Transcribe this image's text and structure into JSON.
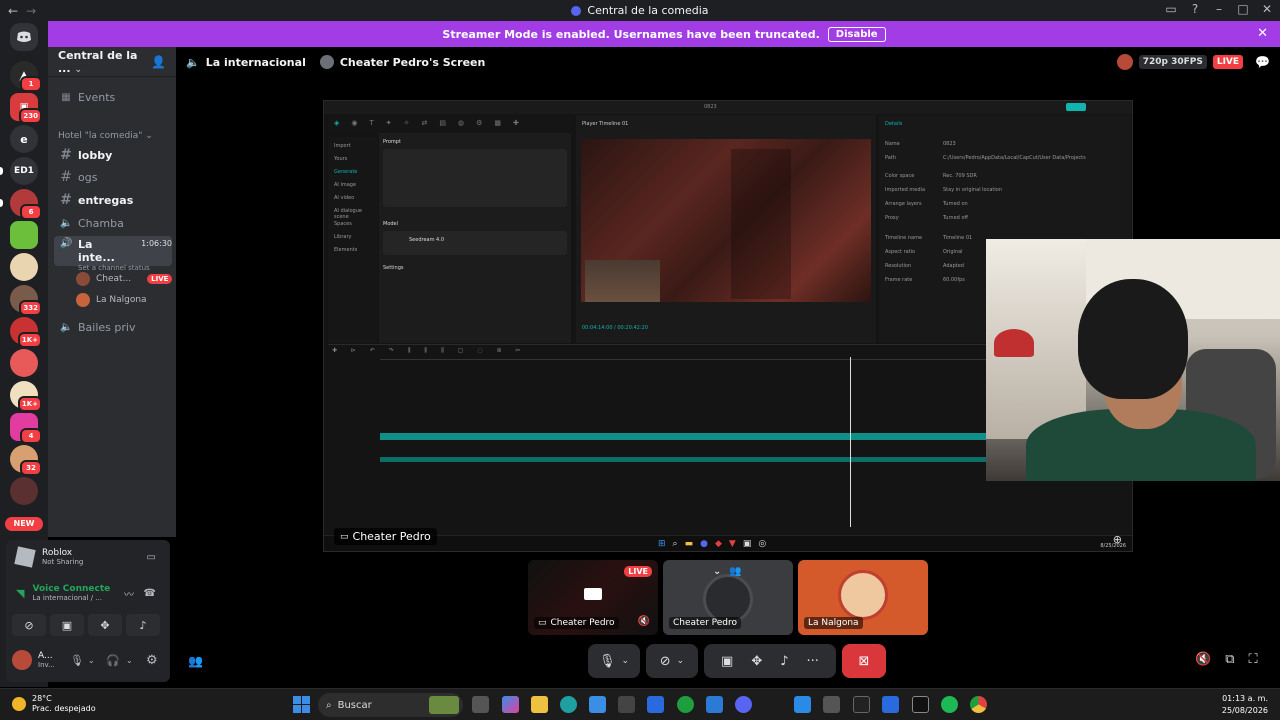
{
  "window": {
    "title": "Central de la comedia",
    "back": "←",
    "forward": "→"
  },
  "banner": {
    "text": "Streamer Mode is enabled. Usernames have been truncated.",
    "disable_label": "Disable",
    "close": "✕"
  },
  "rail": {
    "servers": [
      {
        "badge": "1"
      },
      {
        "badge": "230"
      },
      {
        "label": "e"
      },
      {
        "label": "ED1"
      },
      {
        "badge": "6"
      },
      {
        "badge": ""
      },
      {
        "badge": ""
      },
      {
        "badge": "332"
      },
      {
        "badge": "1K+"
      },
      {
        "badge": ""
      },
      {
        "badge": "1K+"
      },
      {
        "badge": "4"
      },
      {
        "badge": "32"
      },
      {
        "badge": ""
      }
    ],
    "new_label": "NEW"
  },
  "sidebar": {
    "server_name": "Central de la ...",
    "events_label": "Events",
    "category": "Hotel \"la comedia\"",
    "channels": [
      {
        "name": "lobby",
        "type": "text",
        "bold": true
      },
      {
        "name": "ogs",
        "type": "text",
        "bold": false
      },
      {
        "name": "entregas",
        "type": "text",
        "bold": true
      },
      {
        "name": "Chamba",
        "type": "voice",
        "bold": false
      },
      {
        "name": "La inte...",
        "type": "voice",
        "bold": true,
        "active": true,
        "time": "1:06:30",
        "status": "Set a channel status"
      },
      {
        "name": "Bailes priv",
        "type": "voice",
        "bold": false
      }
    ],
    "voice_users": [
      {
        "name": "Cheat...",
        "live": "LIVE"
      },
      {
        "name": "La Nalgona"
      }
    ]
  },
  "panel": {
    "game_name": "Roblox",
    "game_status": "Not Sharing",
    "voice_title": "Voice Connecte",
    "voice_sub": "La internacional / ...",
    "user_name": "A...",
    "user_sub": "Inv..."
  },
  "stage": {
    "channel": "La internacional",
    "screen_title": "Cheater Pedro's Screen",
    "quality": "720p 30FPS",
    "live": "LIVE"
  },
  "screen": {
    "label": "Cheater Pedro",
    "app": {
      "player_title": "Player  Timeline 01",
      "details_title": "Details",
      "prompt_label": "Prompt",
      "model_label": "Model",
      "model_name": "Seedream 4.0",
      "settings_label": "Settings",
      "menu": [
        "Import",
        "Yours",
        "Generate",
        "AI image",
        "AI video",
        "AI dialogue scene",
        "Spaces",
        "Library",
        "Elements"
      ],
      "details_rows": [
        [
          "Name",
          "0823"
        ],
        [
          "Path",
          "C:/Users/Pedro/AppData/Local/CapCut/User Data/Projects"
        ],
        [
          "Color space",
          "Rec. 709 SDR"
        ],
        [
          "Imported media",
          "Stay in original location"
        ],
        [
          "Arrange layers",
          "Turned on"
        ],
        [
          "Proxy",
          "Turned off"
        ],
        [
          "Timeline name",
          "Timeline 01"
        ],
        [
          "Aspect ratio",
          "Original"
        ],
        [
          "Resolution",
          "Adapted"
        ],
        [
          "Frame rate",
          "60.00fps"
        ]
      ],
      "date": "8/25/2026"
    }
  },
  "thumbs": [
    {
      "name": "Cheater Pedro",
      "live": "LIVE"
    },
    {
      "name": "Cheater Pedro"
    },
    {
      "name": "La Nalgona"
    }
  ],
  "controls": {
    "more": "···"
  },
  "taskbar": {
    "temp": "28°C",
    "weather": "Prac. despejado",
    "search": "Buscar",
    "time": "01:13 a. m.",
    "date": "25/08/2026"
  }
}
